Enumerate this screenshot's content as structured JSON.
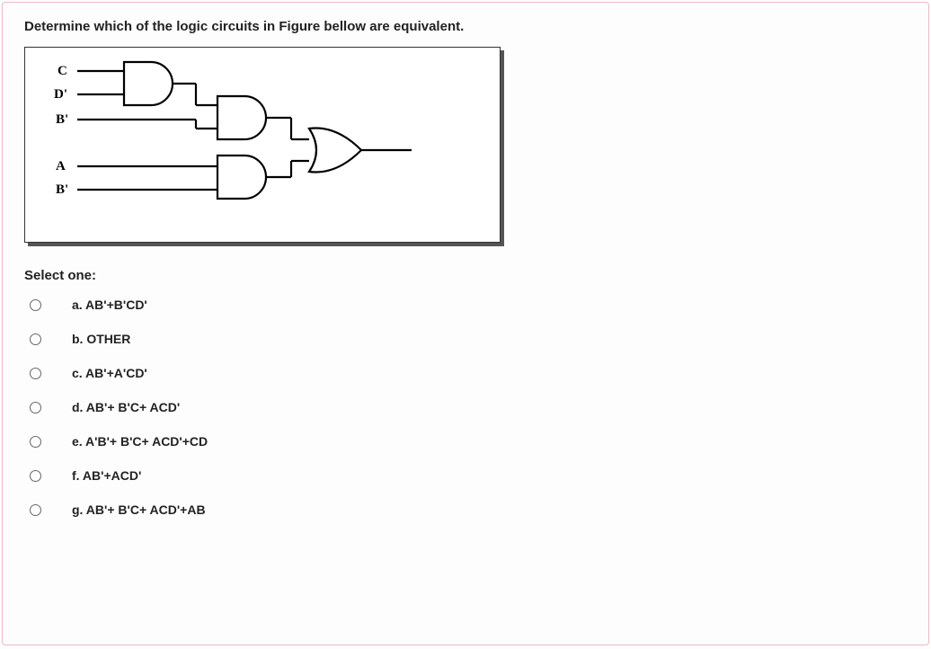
{
  "question": "Determine which of the logic circuits in Figure bellow are equivalent.",
  "selectLabel": "Select one:",
  "circuit": {
    "inputs": {
      "top1": "C",
      "top2": "D'",
      "mid": "B'",
      "bot1": "A",
      "bot2": "B'"
    }
  },
  "options": [
    {
      "text": "a. AB'+B'CD'"
    },
    {
      "text": "b. OTHER"
    },
    {
      "text": "c. AB'+A'CD'"
    },
    {
      "text": "d. AB'+ B'C+ ACD'"
    },
    {
      "text": "e. A'B'+ B'C+ ACD'+CD"
    },
    {
      "text": "f. AB'+ACD'"
    },
    {
      "text": "g.  AB'+ B'C+ ACD'+AB"
    }
  ]
}
